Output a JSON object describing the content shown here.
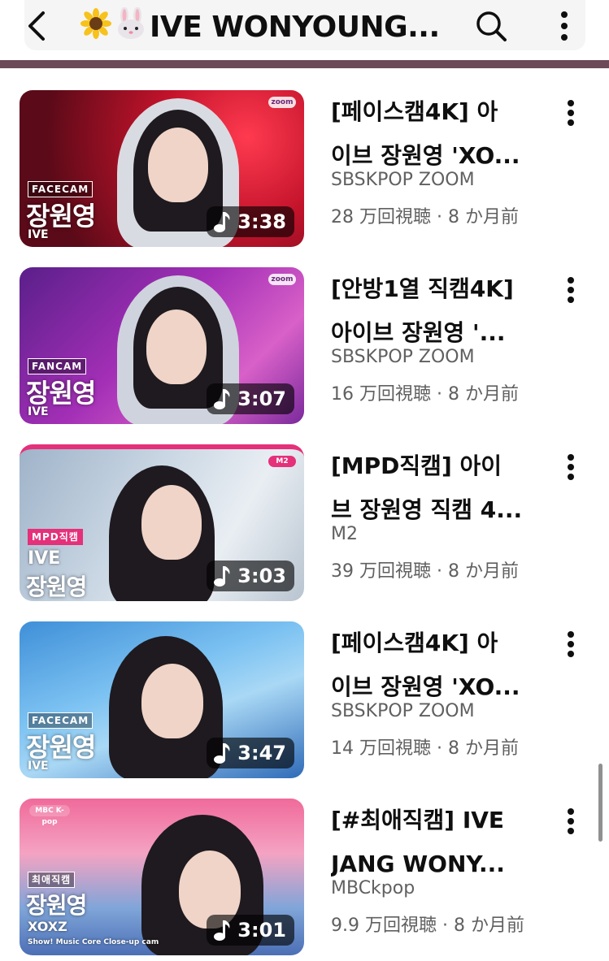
{
  "header": {
    "title": "IVE WONYOUNG...",
    "title_emojis": [
      "sunflower-emoji",
      "rabbit-emoji"
    ],
    "back_icon": "back-arrow-icon",
    "search_icon": "search-icon",
    "more_icon": "more-vertical-icon"
  },
  "videos": [
    {
      "title_line1": "[페이스캠4K] 아",
      "title_line2": "이브 장원영 'XO...",
      "channel": "SBSKPOP ZOOM",
      "meta": "28 万回視聴 · 8 か月前",
      "duration": "3:38",
      "thumb": {
        "tag": "FACECAM",
        "big": "장원영",
        "small": "IVE",
        "logo": "zoom"
      }
    },
    {
      "title_line1": "[안방1열 직캠4K]",
      "title_line2": "아이브 장원영 '...",
      "channel": "SBSKPOP ZOOM",
      "meta": "16 万回視聴 · 8 か月前",
      "duration": "3:07",
      "thumb": {
        "tag": "FANCAM",
        "big": "장원영",
        "small": "IVE",
        "logo": "zoom"
      }
    },
    {
      "title_line1": "[MPD직캠] 아이",
      "title_line2": "브 장원영 직캠 4...",
      "channel": "M2",
      "meta": "39 万回視聴 · 8 か月前",
      "duration": "3:03",
      "thumb": {
        "tag": "MPD직캠",
        "big": "장원영",
        "small": "IVE",
        "logo": "M2"
      }
    },
    {
      "title_line1": "[페이스캠4K] 아",
      "title_line2": "이브 장원영 'XO...",
      "channel": "SBSKPOP ZOOM",
      "meta": "14 万回視聴 · 8 か月前",
      "duration": "3:47",
      "thumb": {
        "tag": "FACECAM",
        "big": "장원영",
        "small": "IVE",
        "logo": ""
      }
    },
    {
      "title_line1": "[#최애직캠] IVE",
      "title_line2": "JANG WONY...",
      "channel": "MBCkpop",
      "meta": "9.9 万回視聴 · 8 か月前",
      "duration": "3:01",
      "thumb": {
        "tag": "최애직캠",
        "big": "장원영",
        "small": "XOXZ",
        "logo": "MBC K-pop",
        "footer": "Show! Music Core Close-up cam"
      }
    }
  ]
}
